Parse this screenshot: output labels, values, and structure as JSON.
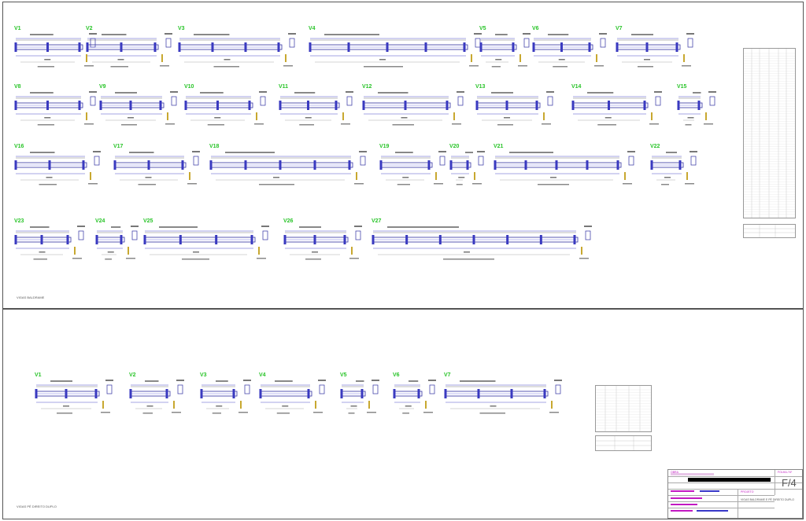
{
  "sheets": {
    "top_label": "VIGAS BALDRAME",
    "bottom_label": "VIGAS PÉ DIREITO DUPLO"
  },
  "beams_top": [
    {
      "id": "V1"
    },
    {
      "id": "V2"
    },
    {
      "id": "V3"
    },
    {
      "id": "V4"
    },
    {
      "id": "V5"
    },
    {
      "id": "V6"
    },
    {
      "id": "V7"
    },
    {
      "id": "V8"
    },
    {
      "id": "V9"
    },
    {
      "id": "V10"
    },
    {
      "id": "V11"
    },
    {
      "id": "V12"
    },
    {
      "id": "V13"
    },
    {
      "id": "V14"
    },
    {
      "id": "V15"
    },
    {
      "id": "V16"
    },
    {
      "id": "V17"
    },
    {
      "id": "V18"
    },
    {
      "id": "V19"
    },
    {
      "id": "V20"
    },
    {
      "id": "V21"
    },
    {
      "id": "V22"
    },
    {
      "id": "V23"
    },
    {
      "id": "V24"
    },
    {
      "id": "V25"
    },
    {
      "id": "V26"
    },
    {
      "id": "V27"
    }
  ],
  "beams_bottom": [
    {
      "id": "V1"
    },
    {
      "id": "V2"
    },
    {
      "id": "V3"
    },
    {
      "id": "V4"
    },
    {
      "id": "V5"
    },
    {
      "id": "V6"
    },
    {
      "id": "V7"
    }
  ],
  "title_block": {
    "obra_label": "OBRA",
    "folha_label": "FOLHA / Nº",
    "sheet_number": "F/4",
    "projeto_label": "PROJETO",
    "projeto_value": "VIGAS BALDRAME E PÉ DIREITO DUPLO",
    "colors": {
      "label": "#c218c2",
      "value": "#3838c8",
      "beam_id": "#28c428"
    }
  }
}
